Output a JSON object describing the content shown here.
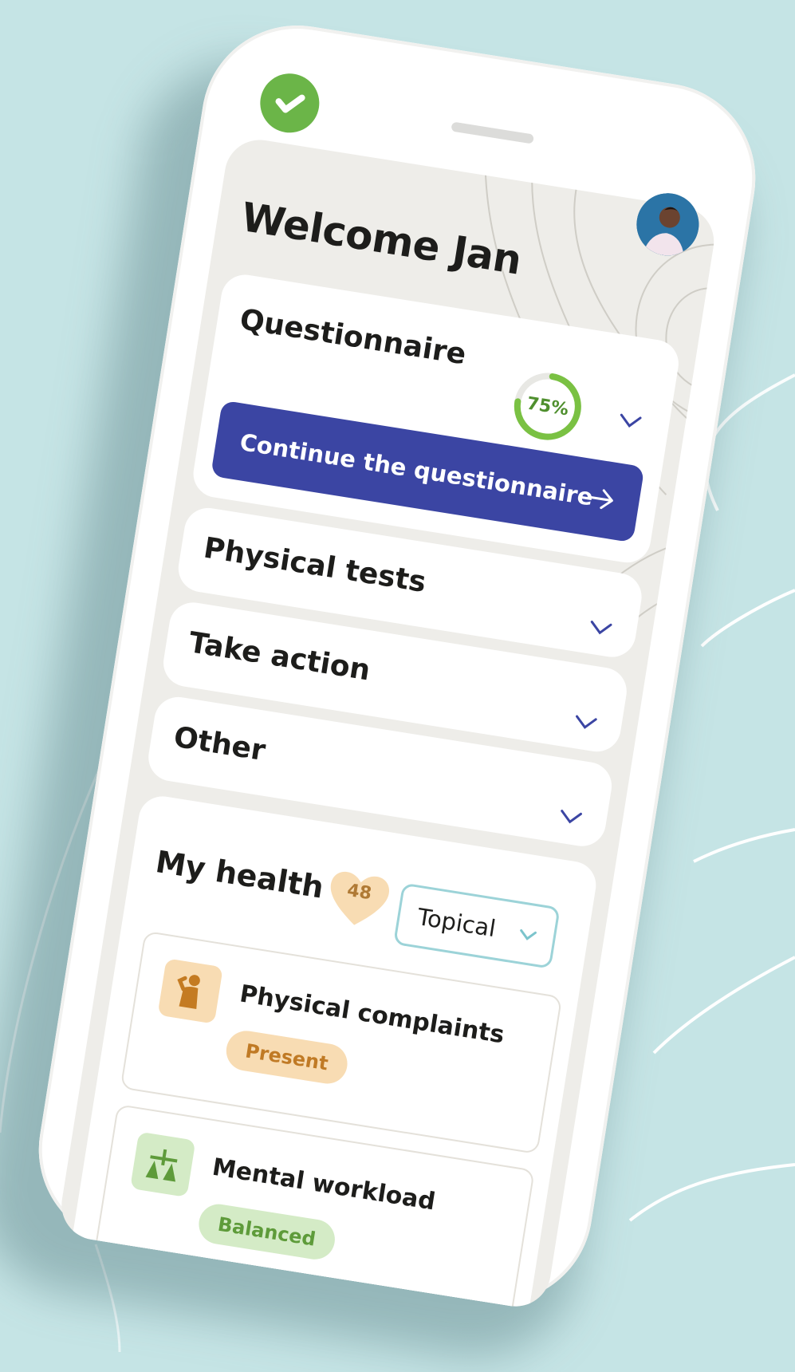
{
  "welcome_text": "Welcome Jan",
  "questionnaire": {
    "title": "Questionnaire",
    "progress_label": "75%",
    "progress_fraction": 0.75,
    "cta_label": "Continue the questionnaire",
    "cta_icon": "arrow-right-icon"
  },
  "sections": [
    {
      "title": "Physical tests",
      "icon": "chevron-down-icon"
    },
    {
      "title": "Take action",
      "icon": "chevron-down-icon"
    },
    {
      "title": "Other",
      "icon": "chevron-down-icon"
    }
  ],
  "my_health": {
    "title": "My health",
    "score": "48",
    "filter": {
      "selected": "Topical",
      "icon": "chevron-down-icon"
    },
    "items": [
      {
        "title": "Physical complaints",
        "status": "Present",
        "icon": "person-shoulder-pain-icon"
      },
      {
        "title": "Mental workload",
        "status": "Balanced",
        "icon": "balance-scale-icon"
      }
    ]
  },
  "colors": {
    "background": "#c5e4e5",
    "screen": "#eeede9",
    "primary_button": "#3b45a3",
    "check_green": "#6bb548",
    "progress_green": "#7ac143",
    "chevron_blue": "#3b45a3",
    "dropdown_border": "#9cd3d8",
    "heart_bg": "#f8dcb3",
    "present_bg": "#f8dcb3",
    "present_text": "#c07a25",
    "balanced_bg": "#d4ebc6",
    "balanced_text": "#5e9b3a"
  }
}
